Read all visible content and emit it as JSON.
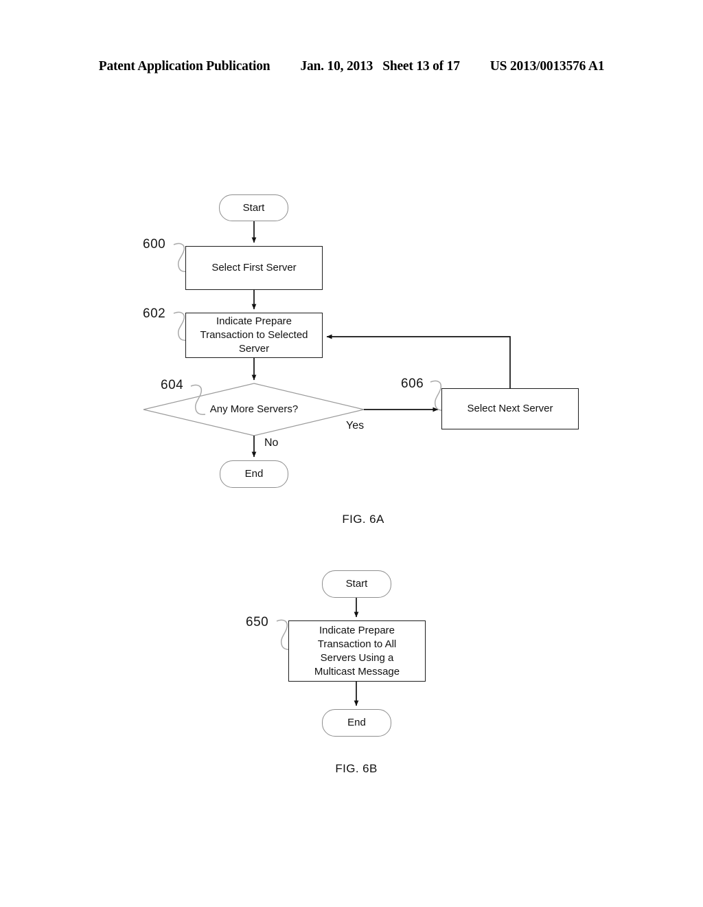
{
  "header": {
    "publication": "Patent Application Publication",
    "date": "Jan. 10, 2013",
    "sheet": "Sheet 13 of 17",
    "pub_number": "US 2013/0013576 A1"
  },
  "figures": [
    {
      "caption": "FIG. 6A",
      "nodes": {
        "start": "Start",
        "select_first_server": "Select First Server",
        "indicate_prepare_selected": "Indicate Prepare Transaction to Selected Server",
        "decision": "Any More Servers?",
        "select_next_server": "Select Next Server",
        "end": "End"
      },
      "refs": {
        "select_first_server": "600",
        "indicate_prepare_selected": "602",
        "decision": "604",
        "select_next_server": "606"
      },
      "edge_labels": {
        "yes": "Yes",
        "no": "No"
      }
    },
    {
      "caption": "FIG. 6B",
      "nodes": {
        "start": "Start",
        "indicate_prepare_multicast": "Indicate Prepare Transaction to All Servers Using a Multicast Message",
        "end": "End"
      },
      "refs": {
        "indicate_prepare_multicast": "650"
      }
    }
  ],
  "colors": {
    "ink": "#000000",
    "paper": "#ffffff",
    "light_outline": "#8e8e8e",
    "dark_outline": "#1c1c1c"
  }
}
